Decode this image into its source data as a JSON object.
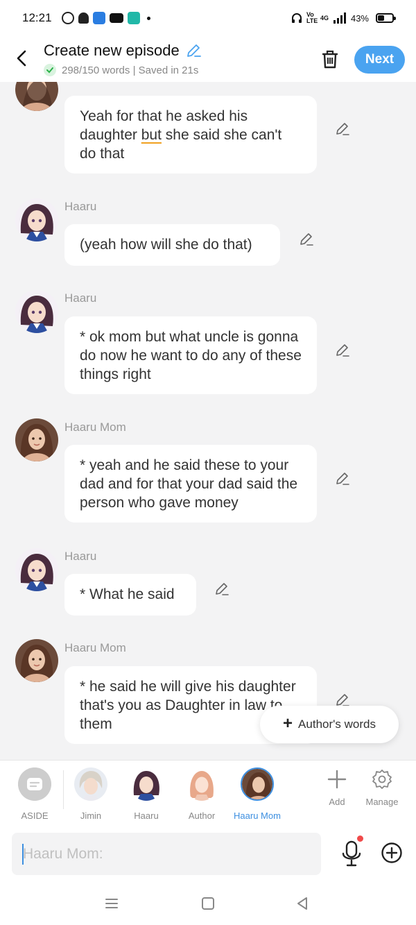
{
  "status_bar": {
    "time": "12:21",
    "network": "4G",
    "volte": "Vo LTE",
    "battery": "43%"
  },
  "header": {
    "title": "Create new episode",
    "word_count": "298/150 words | Saved in 21s",
    "next_label": "Next"
  },
  "messages": [
    {
      "speaker": "Haaru Mom",
      "text_parts": [
        "Yeah for that he asked his daughter ",
        "but",
        " she said she can't do that"
      ]
    },
    {
      "speaker": "Haaru",
      "text": "(yeah how will she do that)"
    },
    {
      "speaker": "Haaru",
      "text": "* ok mom but what uncle is gonna do now he want to do any of these things right"
    },
    {
      "speaker": "Haaru Mom",
      "text": "* yeah and he said these to your dad and for that your dad said the person who gave money"
    },
    {
      "speaker": "Haaru",
      "text": "* What he said"
    },
    {
      "speaker": "Haaru Mom",
      "text": "* he said he will give his daughter that's you as Daughter in law to them"
    }
  ],
  "authors_words_label": "Author's words",
  "characters": [
    {
      "label": "ASIDE"
    },
    {
      "label": "Jimin"
    },
    {
      "label": "Haaru"
    },
    {
      "label": "Author"
    },
    {
      "label": "Haaru Mom",
      "selected": true
    }
  ],
  "tools": [
    {
      "label": "Add"
    },
    {
      "label": "Manage"
    }
  ],
  "input": {
    "placeholder": "Haaru Mom:",
    "value": ""
  },
  "colors": {
    "accent": "#4aa3f0",
    "selected_label": "#3d8fe0",
    "background": "#f3f3f4",
    "record_dot": "#f04a4a"
  }
}
